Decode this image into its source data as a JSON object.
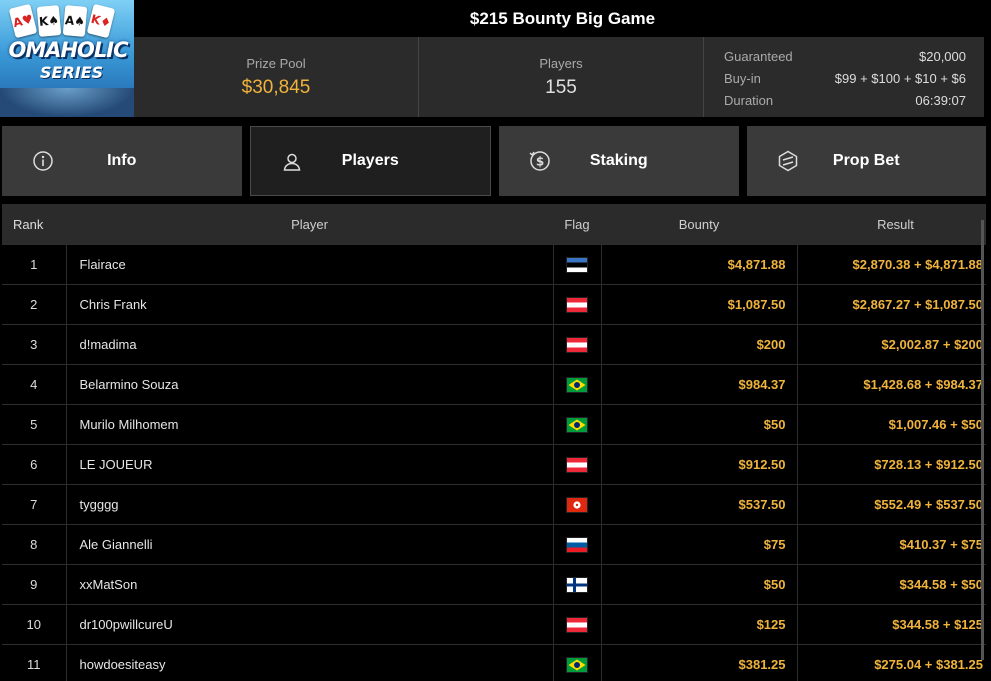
{
  "header": {
    "title": "$215 Bounty Big Game",
    "logo": {
      "brand": "OMAHOLIC",
      "series": "SERIES",
      "cards": [
        "A♥",
        "K♠",
        "A♠",
        "K♦"
      ]
    },
    "prize_pool_label": "Prize Pool",
    "prize_pool_value": "$30,845",
    "players_label": "Players",
    "players_value": "155",
    "details": [
      {
        "label": "Guaranteed",
        "value": "$20,000"
      },
      {
        "label": "Buy-in",
        "value": "$99 + $100 + $10 + $6"
      },
      {
        "label": "Duration",
        "value": "06:39:07"
      }
    ]
  },
  "tabs": [
    {
      "label": "Info",
      "icon": "info-icon",
      "active": false
    },
    {
      "label": "Players",
      "icon": "user-icon",
      "active": true
    },
    {
      "label": "Staking",
      "icon": "dollar-coin-icon",
      "active": false
    },
    {
      "label": "Prop Bet",
      "icon": "prop-bet-icon",
      "active": false
    }
  ],
  "table": {
    "columns": [
      "Rank",
      "Player",
      "Flag",
      "Bounty",
      "Result"
    ],
    "rows": [
      {
        "rank": "1",
        "player": "Flairace",
        "flag": "estonia",
        "bounty": "$4,871.88",
        "result": "$2,870.38 + $4,871.88"
      },
      {
        "rank": "2",
        "player": "Chris Frank",
        "flag": "austria",
        "bounty": "$1,087.50",
        "result": "$2,867.27 + $1,087.50"
      },
      {
        "rank": "3",
        "player": "d!madima",
        "flag": "austria",
        "bounty": "$200",
        "result": "$2,002.87 + $200"
      },
      {
        "rank": "4",
        "player": "Belarmino Souza",
        "flag": "brazil",
        "bounty": "$984.37",
        "result": "$1,428.68 + $984.37"
      },
      {
        "rank": "5",
        "player": "Murilo Milhomem",
        "flag": "brazil",
        "bounty": "$50",
        "result": "$1,007.46 + $50"
      },
      {
        "rank": "6",
        "player": "LE JOUEUR",
        "flag": "austria",
        "bounty": "$912.50",
        "result": "$728.13 + $912.50"
      },
      {
        "rank": "7",
        "player": "tygggg",
        "flag": "hong-kong",
        "bounty": "$537.50",
        "result": "$552.49 + $537.50"
      },
      {
        "rank": "8",
        "player": "Ale Giannelli",
        "flag": "slovenia",
        "bounty": "$75",
        "result": "$410.37 + $75"
      },
      {
        "rank": "9",
        "player": "xxMatSon",
        "flag": "finland",
        "bounty": "$50",
        "result": "$344.58 + $50"
      },
      {
        "rank": "10",
        "player": "dr100pwillcureU",
        "flag": "austria",
        "bounty": "$125",
        "result": "$344.58 + $125"
      },
      {
        "rank": "11",
        "player": "howdoesiteasy",
        "flag": "brazil",
        "bounty": "$381.25",
        "result": "$275.04 + $381.25"
      }
    ]
  },
  "colors": {
    "gold": "#f0b33c",
    "panel": "#2b2b2b",
    "tab": "#3a3a3a"
  }
}
